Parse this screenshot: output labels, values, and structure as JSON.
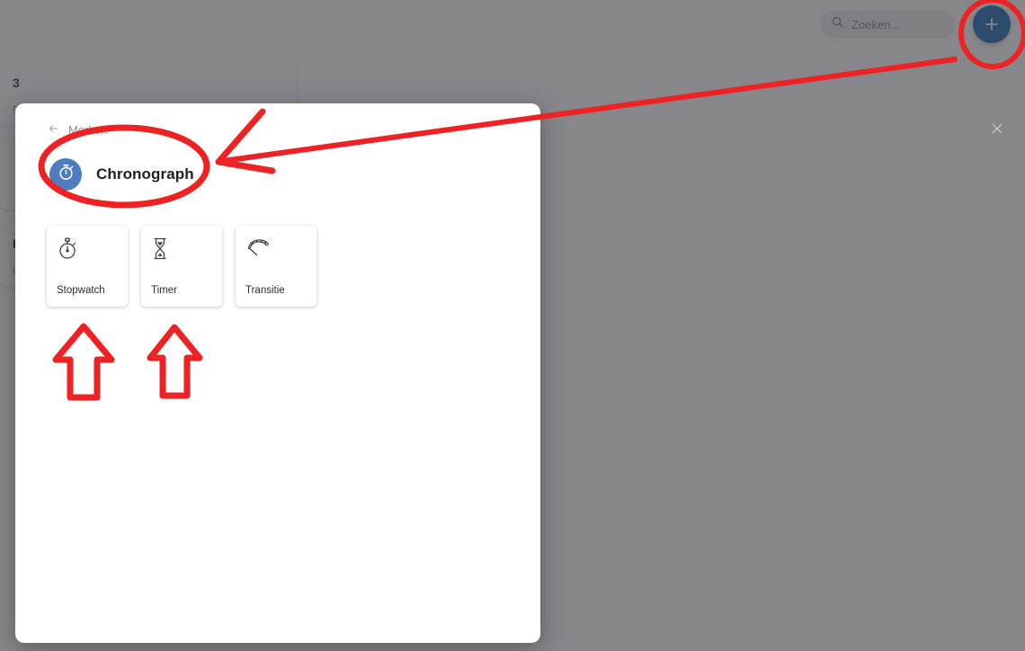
{
  "topbar": {
    "search": {
      "placeholder": "Zoeken...",
      "value": "",
      "icon": "search-icon"
    },
    "add_button": {
      "label": "+",
      "icon": "plus-icon",
      "color": "#1565a8"
    }
  },
  "background_cards": [
    {
      "title": "3",
      "subtitle": "geze"
    },
    {
      "title": "",
      "subtitle": ""
    },
    {
      "title": "B",
      "subtitle": "geze"
    }
  ],
  "modal": {
    "back_label": "Merken",
    "back_icon": "arrow-left-icon",
    "close_icon": "close-icon",
    "avatar_icon": "stopwatch-icon",
    "avatar_color": "#4d7dbe",
    "title": "Chronograph",
    "options": [
      {
        "label": "Stopwatch",
        "icon": "stopwatch-icon"
      },
      {
        "label": "Timer",
        "icon": "hourglass-icon"
      },
      {
        "label": "Transitie",
        "icon": "gauge-icon"
      }
    ]
  },
  "annotations": {
    "color": "#ee2222",
    "circle_fab": "circle-highlight-add-button",
    "circle_title": "circle-highlight-chronograph",
    "arrow_to_title": "arrow-pointing-to-chronograph",
    "arrow_up_stopwatch": "arrow-up-stopwatch",
    "arrow_up_timer": "arrow-up-timer"
  }
}
